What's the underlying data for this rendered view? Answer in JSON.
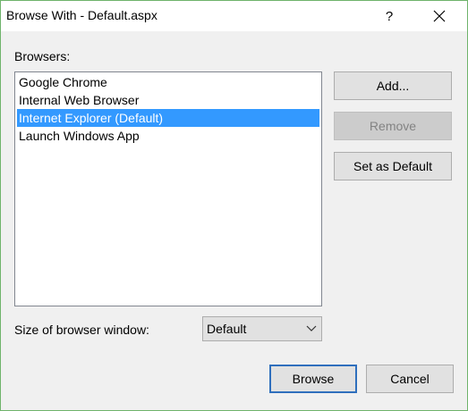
{
  "window": {
    "title": "Browse With - Default.aspx",
    "help_glyph": "?",
    "close_icon": "close-icon"
  },
  "browsers": {
    "label": "Browsers:",
    "items": [
      {
        "label": "Google Chrome",
        "selected": false
      },
      {
        "label": "Internal Web Browser",
        "selected": false
      },
      {
        "label": "Internet Explorer (Default)",
        "selected": true
      },
      {
        "label": "Launch Windows App",
        "selected": false
      }
    ]
  },
  "buttons": {
    "add": "Add...",
    "remove": "Remove",
    "set_default": "Set as Default",
    "browse": "Browse",
    "cancel": "Cancel"
  },
  "size": {
    "label": "Size of browser window:",
    "selected": "Default"
  },
  "colors": {
    "selection": "#3399ff",
    "window_border": "#6fb36b",
    "default_button_border": "#2f6fbd"
  }
}
